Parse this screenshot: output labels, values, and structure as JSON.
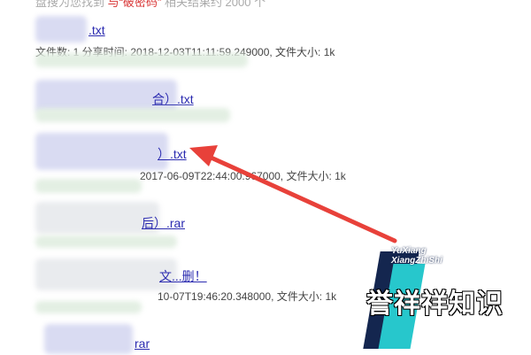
{
  "top_line": {
    "prefix": "盘搜为您找到",
    "highlight": "与“破密码”",
    "suffix": "相关结果约 2000 个"
  },
  "results": [
    {
      "title": ".txt",
      "meta": "文件数: 1 分享时间: 2018-12-03T11:11:59.249000, 文件大小: 1k"
    },
    {
      "title": "合）.txt",
      "meta": ""
    },
    {
      "title": "）.txt",
      "meta": "2017-06-09T22:44:00.967000, 文件大小: 1k"
    },
    {
      "title": "后）.rar",
      "meta": ""
    },
    {
      "title": "文...删！",
      "meta": "10-07T19:46:20.348000, 文件大小: 1k"
    },
    {
      "title": "rar",
      "meta": ""
    }
  ],
  "watermark": {
    "line1": "YuXiang",
    "line2": "XiangZhiShi",
    "main": "誉祥祥知识"
  },
  "colors": {
    "link": "#2b2bb0",
    "arrow": "#e8413a",
    "watermark_dark": "#14264f",
    "watermark_teal": "#27c7cc"
  }
}
